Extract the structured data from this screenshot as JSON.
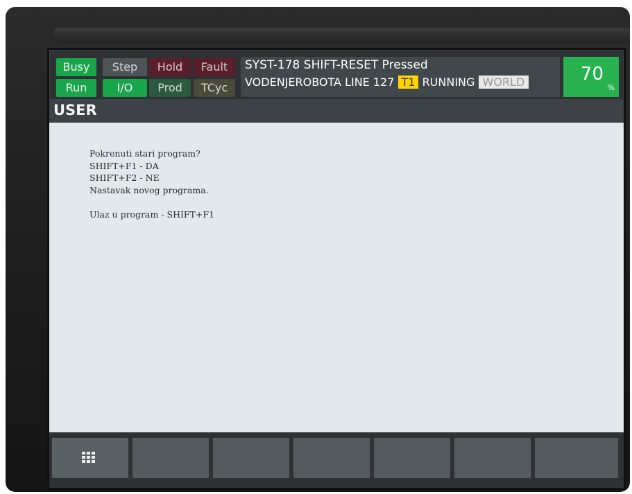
{
  "status_lamps": {
    "busy": "Busy",
    "step": "Step",
    "hold": "Hold",
    "fault": "Fault",
    "run": "Run",
    "io": "I/O",
    "prod": "Prod",
    "tcyc": "TCyc"
  },
  "message": {
    "alarm": "SYST-178 SHIFT-RESET Pressed",
    "program": "VODENJEROBOTA",
    "line_label": "LINE",
    "line_number": "127",
    "mode": "T1",
    "state": "RUNNING",
    "coord": "WORLD"
  },
  "override": {
    "value": "70",
    "unit": "%"
  },
  "screen_title": "USER",
  "user_lines": [
    "Pokrenuti stari program?",
    "SHIFT+F1 - DA",
    "SHIFT+F2 - NE",
    "Nastavak novog programa.",
    "",
    "Ulaz u program - SHIFT+F1"
  ],
  "function_keys": [
    "",
    "",
    "",
    "",
    "",
    "",
    ""
  ],
  "icons": {
    "menu": "grid-menu-icon"
  },
  "colors": {
    "lamp_active": "#19a64a",
    "override_bg": "#27b14f",
    "mode_badge": "#ffd400",
    "content_bg": "#e1e9ec"
  }
}
